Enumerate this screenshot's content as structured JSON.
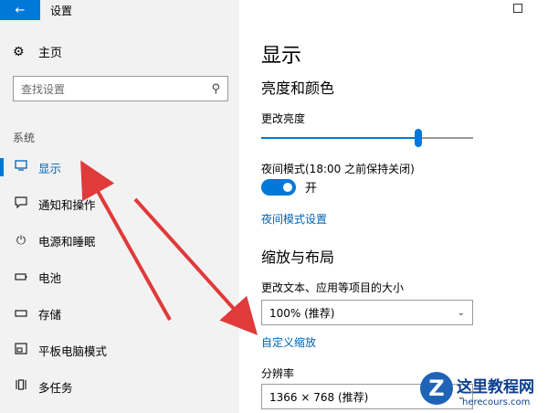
{
  "window": {
    "title": "设置",
    "back_icon": "arrow-left-icon",
    "restore_icon": "square-icon"
  },
  "sidebar": {
    "home_label": "主页",
    "home_icon": "gear-icon",
    "search_placeholder": "查找设置",
    "search_icon": "search-icon",
    "section_label": "系统",
    "items": [
      {
        "label": "显示",
        "icon": "monitor-icon",
        "active": true
      },
      {
        "label": "通知和操作",
        "icon": "message-icon",
        "active": false
      },
      {
        "label": "电源和睡眠",
        "icon": "power-icon",
        "active": false
      },
      {
        "label": "电池",
        "icon": "battery-icon",
        "active": false
      },
      {
        "label": "存储",
        "icon": "drive-icon",
        "active": false
      },
      {
        "label": "平板电脑模式",
        "icon": "tablet-mode-icon",
        "active": false
      },
      {
        "label": "多任务",
        "icon": "multitask-icon",
        "active": false
      }
    ]
  },
  "main": {
    "title": "显示",
    "brightness_section": "亮度和颜色",
    "brightness_label": "更改亮度",
    "brightness_value": 0.74,
    "night_mode_label": "夜间模式(18:00 之前保持关闭)",
    "night_mode_toggle_state": "开",
    "night_mode_settings_link": "夜间模式设置",
    "scale_section": "缩放与布局",
    "scale_label": "更改文本、应用等项目的大小",
    "scale_value": "100% (推荐)",
    "custom_scale_link": "自定义缩放",
    "resolution_label": "分辨率",
    "resolution_value": "1366 × 768 (推荐)"
  },
  "watermark": {
    "letter": "Z",
    "brand": "这里教程网",
    "url": "herecours.com"
  },
  "colors": {
    "accent": "#0078d7",
    "link": "#0063b1",
    "arrow": "#e03a3a"
  }
}
